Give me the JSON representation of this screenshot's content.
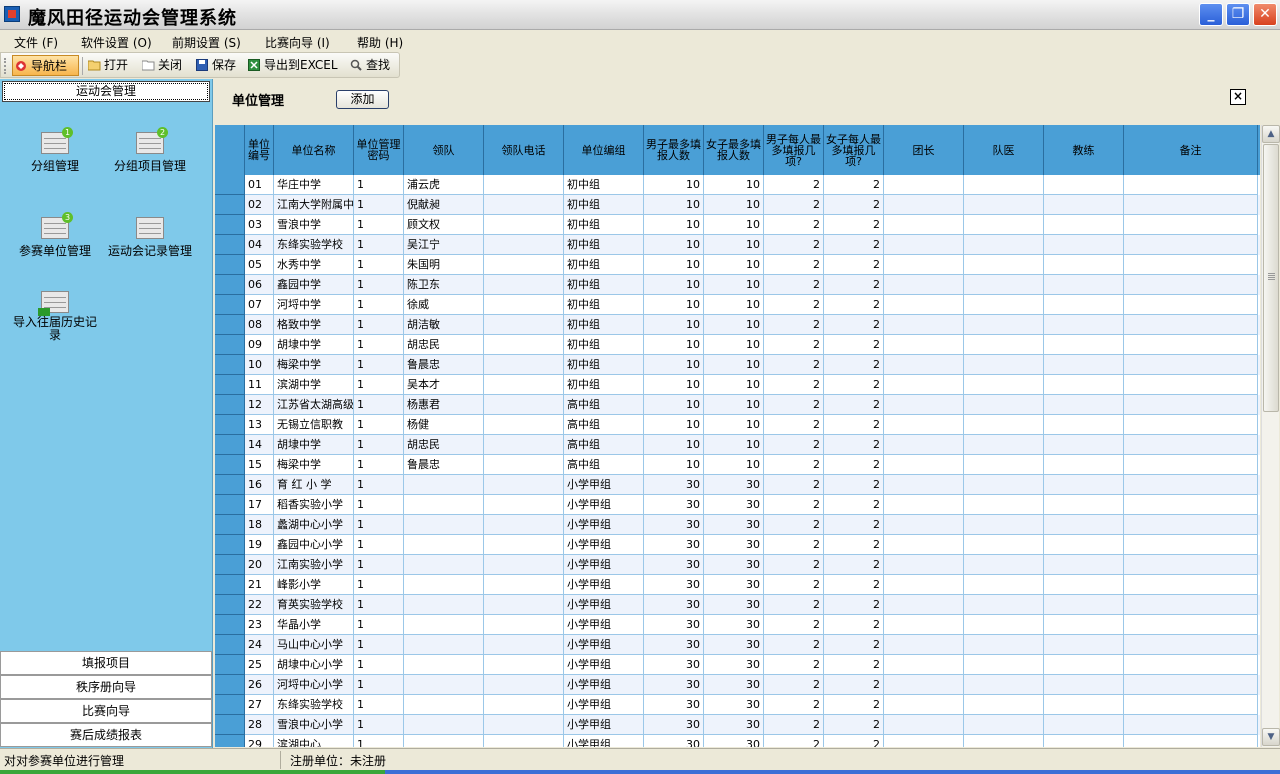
{
  "window": {
    "title": "魔风田径运动会管理系统",
    "min_label": "_",
    "max_label": "❐",
    "close_label": "✕"
  },
  "menu": [
    "文件 (F)",
    "软件设置 (O)",
    "前期设置 (S)",
    "比赛向导 (I)",
    "帮助 (H)"
  ],
  "toolbar": {
    "nav_label": "导航栏",
    "open_label": "打开",
    "close_label": "关闭",
    "save_label": "保存",
    "export_label": "导出到EXCEL",
    "find_label": "查找"
  },
  "sidebar": {
    "header": "运动会管理",
    "tiles": [
      {
        "label": "分组管理",
        "badge": "1"
      },
      {
        "label": "分组项目管理",
        "badge": "2"
      },
      {
        "label": "参赛单位管理",
        "badge": "3"
      },
      {
        "label": "运动会记录管理",
        "badge": ""
      },
      {
        "label": "导入往届历史记录",
        "badge": ""
      }
    ],
    "bottom_items": [
      "填报项目",
      "秩序册向导",
      "比赛向导",
      "赛后成绩报表"
    ]
  },
  "main": {
    "title": "单位管理",
    "add_label": "添加",
    "close_label": "×"
  },
  "grid": {
    "columns": [
      "单位编号",
      "单位名称",
      "单位管理密码",
      "领队",
      "领队电话",
      "单位编组",
      "男子最多填报人数",
      "女子最多填报人数",
      "男子每人最多填报几项?",
      "女子每人最多填报几项?",
      "团长",
      "队医",
      "教练",
      "备注"
    ],
    "rows": [
      [
        "01",
        "华庄中学",
        "1",
        "浦云虎",
        "",
        "初中组",
        "10",
        "10",
        "2",
        "2"
      ],
      [
        "02",
        "江南大学附属中",
        "1",
        "倪献昶",
        "",
        "初中组",
        "10",
        "10",
        "2",
        "2"
      ],
      [
        "03",
        "雪浪中学",
        "1",
        "顾文权",
        "",
        "初中组",
        "10",
        "10",
        "2",
        "2"
      ],
      [
        "04",
        "东绛实验学校",
        "1",
        "吴江宁",
        "",
        "初中组",
        "10",
        "10",
        "2",
        "2"
      ],
      [
        "05",
        "水秀中学",
        "1",
        "朱国明",
        "",
        "初中组",
        "10",
        "10",
        "2",
        "2"
      ],
      [
        "06",
        "鑫园中学",
        "1",
        "陈卫东",
        "",
        "初中组",
        "10",
        "10",
        "2",
        "2"
      ],
      [
        "07",
        "河埒中学",
        "1",
        "徐威",
        "",
        "初中组",
        "10",
        "10",
        "2",
        "2"
      ],
      [
        "08",
        "格致中学",
        "1",
        "胡洁敏",
        "",
        "初中组",
        "10",
        "10",
        "2",
        "2"
      ],
      [
        "09",
        "胡埭中学",
        "1",
        "胡忠民",
        "",
        "初中组",
        "10",
        "10",
        "2",
        "2"
      ],
      [
        "10",
        "梅梁中学",
        "1",
        "鲁晨忠",
        "",
        "初中组",
        "10",
        "10",
        "2",
        "2"
      ],
      [
        "11",
        "滨湖中学",
        "1",
        "吴本才",
        "",
        "初中组",
        "10",
        "10",
        "2",
        "2"
      ],
      [
        "12",
        "江苏省太湖高级",
        "1",
        "杨惠君",
        "",
        "高中组",
        "10",
        "10",
        "2",
        "2"
      ],
      [
        "13",
        "无锡立信职教",
        "1",
        "杨健",
        "",
        "高中组",
        "10",
        "10",
        "2",
        "2"
      ],
      [
        "14",
        "胡埭中学",
        "1",
        "胡忠民",
        "",
        "高中组",
        "10",
        "10",
        "2",
        "2"
      ],
      [
        "15",
        "梅梁中学",
        "1",
        "鲁晨忠",
        "",
        "高中组",
        "10",
        "10",
        "2",
        "2"
      ],
      [
        "16",
        "育 红 小 学",
        "1",
        "",
        "",
        "小学甲组",
        "30",
        "30",
        "2",
        "2"
      ],
      [
        "17",
        "稻香实验小学",
        "1",
        "",
        "",
        "小学甲组",
        "30",
        "30",
        "2",
        "2"
      ],
      [
        "18",
        "蠡湖中心小学",
        "1",
        "",
        "",
        "小学甲组",
        "30",
        "30",
        "2",
        "2"
      ],
      [
        "19",
        "鑫园中心小学",
        "1",
        "",
        "",
        "小学甲组",
        "30",
        "30",
        "2",
        "2"
      ],
      [
        "20",
        "江南实验小学",
        "1",
        "",
        "",
        "小学甲组",
        "30",
        "30",
        "2",
        "2"
      ],
      [
        "21",
        "峰影小学",
        "1",
        "",
        "",
        "小学甲组",
        "30",
        "30",
        "2",
        "2"
      ],
      [
        "22",
        "育英实验学校",
        "1",
        "",
        "",
        "小学甲组",
        "30",
        "30",
        "2",
        "2"
      ],
      [
        "23",
        "华晶小学",
        "1",
        "",
        "",
        "小学甲组",
        "30",
        "30",
        "2",
        "2"
      ],
      [
        "24",
        "马山中心小学",
        "1",
        "",
        "",
        "小学甲组",
        "30",
        "30",
        "2",
        "2"
      ],
      [
        "25",
        "胡埭中心小学",
        "1",
        "",
        "",
        "小学甲组",
        "30",
        "30",
        "2",
        "2"
      ],
      [
        "26",
        "河埒中心小学",
        "1",
        "",
        "",
        "小学甲组",
        "30",
        "30",
        "2",
        "2"
      ],
      [
        "27",
        "东绛实验学校",
        "1",
        "",
        "",
        "小学甲组",
        "30",
        "30",
        "2",
        "2"
      ],
      [
        "28",
        "雪浪中心小学",
        "1",
        "",
        "",
        "小学甲组",
        "30",
        "30",
        "2",
        "2"
      ],
      [
        "29",
        "滨湖中心",
        "1",
        "",
        "",
        "小学甲组",
        "30",
        "30",
        "2",
        "2"
      ]
    ]
  },
  "status": {
    "left": "对对参赛单位进行管理",
    "right": "注册单位：未注册"
  },
  "colors": {
    "sidebar": "#7fc9ea",
    "grid_header": "#4a9fd6",
    "grid_line": "#9bc7e8"
  }
}
